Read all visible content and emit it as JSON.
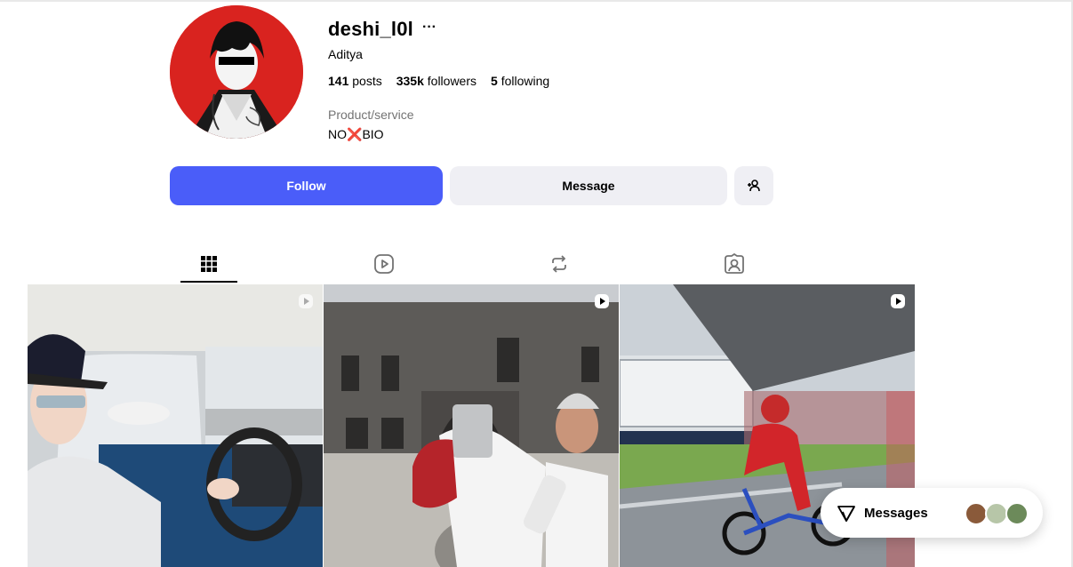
{
  "profile": {
    "username": "deshi_l0l",
    "more_label": "···",
    "full_name": "Aditya",
    "posts_count": "141",
    "posts_label": "posts",
    "followers_count": "335k",
    "followers_label": "followers",
    "following_count": "5",
    "following_label": "following",
    "category": "Product/service",
    "bio_before": "NO",
    "bio_emoji": "❌",
    "bio_after": "BIO"
  },
  "actions": {
    "follow_label": "Follow",
    "message_label": "Message",
    "suggest_icon": "person-add-icon",
    "follow_color": "#4a5df9"
  },
  "tabs": [
    {
      "icon": "grid-icon",
      "active": true
    },
    {
      "icon": "reels-icon",
      "active": false
    },
    {
      "icon": "reposts-icon",
      "active": false
    },
    {
      "icon": "tagged-icon",
      "active": false
    }
  ],
  "posts": [
    {
      "type": "reel",
      "badge_icon": "reel-icon"
    },
    {
      "type": "reel",
      "badge_icon": "reel-icon"
    },
    {
      "type": "reel",
      "badge_icon": "reel-icon"
    }
  ],
  "messages": {
    "label": "Messages",
    "icon": "send-icon"
  }
}
